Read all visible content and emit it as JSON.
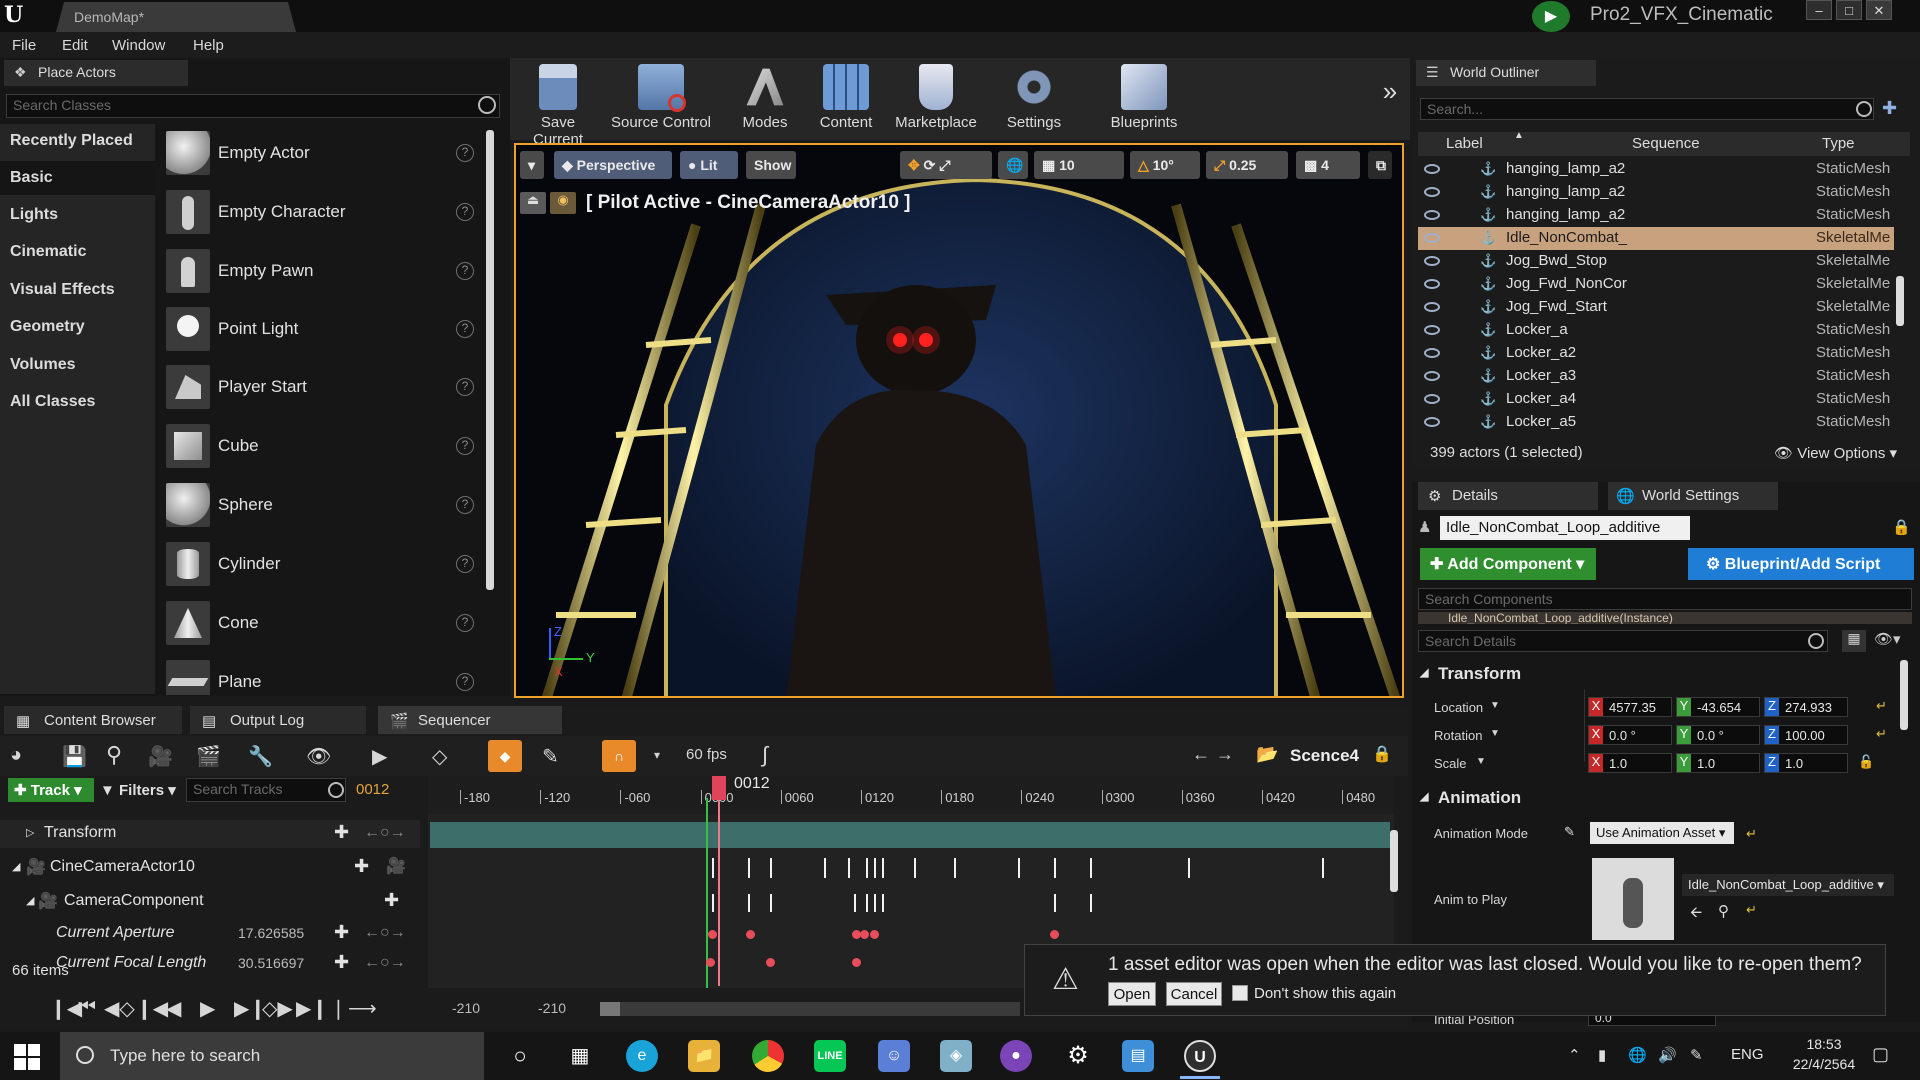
{
  "window": {
    "doc_tab": "DemoMap*",
    "project_name": "Pro2_VFX_Cinematic",
    "buttons": [
      "–",
      "□",
      "✕"
    ]
  },
  "menu": [
    "File",
    "Edit",
    "Window",
    "Help"
  ],
  "place_actors": {
    "tab": "Place Actors",
    "search_placeholder": "Search Classes",
    "categories": [
      "Recently Placed",
      "Basic",
      "Lights",
      "Cinematic",
      "Visual Effects",
      "Geometry",
      "Volumes",
      "All Classes"
    ],
    "selected_category": "Basic",
    "items": [
      "Empty Actor",
      "Empty Character",
      "Empty Pawn",
      "Point Light",
      "Player Start",
      "Cube",
      "Sphere",
      "Cylinder",
      "Cone",
      "Plane"
    ],
    "help": "?"
  },
  "toolbar": {
    "buttons": [
      "Save Current",
      "Source Control",
      "Modes",
      "Content",
      "Marketplace",
      "Settings",
      "Blueprints"
    ],
    "more": "»"
  },
  "viewport": {
    "perspective": "Perspective",
    "lit": "Lit",
    "show": "Show",
    "grid_snap": "10",
    "rotation_snap": "10°",
    "scale_snap": "0.25",
    "camera_speed": "4",
    "pilot_label": "[ Pilot Active - CineCameraActor10 ]",
    "axis_z": "Z",
    "axis_y": "Y",
    "axis_x": "X"
  },
  "outliner": {
    "tab": "World Outliner",
    "search_placeholder": "Search...",
    "col_label": "Label",
    "col_sequence": "Sequence",
    "col_type": "Type",
    "rows": [
      {
        "label": "hanging_lamp_a2",
        "type": "StaticMesh"
      },
      {
        "label": "hanging_lamp_a2",
        "type": "StaticMesh"
      },
      {
        "label": "hanging_lamp_a2",
        "type": "StaticMesh"
      },
      {
        "label": "Idle_NonCombat_",
        "type": "SkeletalMe"
      },
      {
        "label": "Jog_Bwd_Stop",
        "type": "SkeletalMe"
      },
      {
        "label": "Jog_Fwd_NonCor",
        "type": "SkeletalMe"
      },
      {
        "label": "Jog_Fwd_Start",
        "type": "SkeletalMe"
      },
      {
        "label": "Locker_a",
        "type": "StaticMesh"
      },
      {
        "label": "Locker_a2",
        "type": "StaticMesh"
      },
      {
        "label": "Locker_a3",
        "type": "StaticMesh"
      },
      {
        "label": "Locker_a4",
        "type": "StaticMesh"
      },
      {
        "label": "Locker_a5",
        "type": "StaticMesh"
      }
    ],
    "selected_index": 3,
    "count": "399 actors (1 selected)",
    "view_options": "View Options"
  },
  "details": {
    "tab": "Details",
    "world_settings_tab": "World Settings",
    "actor_name": "Idle_NonCombat_Loop_additive",
    "add_component": "Add Component",
    "blueprint_script": "Blueprint/Add Script",
    "search_components": "Search Components",
    "component_row": "Idle_NonCombat_Loop_additive(Instance)",
    "search_details": "Search Details",
    "transform_section": "Transform",
    "location_label": "Location",
    "rotation_label": "Rotation",
    "scale_label": "Scale",
    "location": {
      "x": "4577.35",
      "y": "-43.654",
      "z": "274.933"
    },
    "rotation": {
      "x": "0.0 °",
      "y": "0.0 °",
      "z": "100.00"
    },
    "scale": {
      "x": "1.0",
      "y": "1.0",
      "z": "1.0"
    },
    "animation_section": "Animation",
    "animation_mode_label": "Animation Mode",
    "animation_mode_value": "Use Animation Asset",
    "anim_to_play_label": "Anim to Play",
    "anim_asset": "Idle_NonCombat_Loop_additive",
    "initial_position_label": "Initial Position",
    "initial_position_value": "0.0"
  },
  "bottom_tabs": [
    "Content Browser",
    "Output Log",
    "Sequencer"
  ],
  "sequencer": {
    "fps": "60 fps",
    "sequence_name": "Scence4",
    "track_button": "Track",
    "filters": "Filters",
    "search_tracks_placeholder": "Search Tracks",
    "current_frame": "0012",
    "tracks": [
      {
        "name": "Transform",
        "indent": 1
      },
      {
        "name": "CineCameraActor10",
        "indent": 0
      },
      {
        "name": "CameraComponent",
        "indent": 1
      },
      {
        "name": "Current Aperture",
        "indent": 2,
        "value": "17.626585"
      },
      {
        "name": "Current Focal Length",
        "indent": 2,
        "value": "30.516697"
      }
    ],
    "item_count": "66 items",
    "ruler": [
      "-180",
      "-120",
      "-060",
      "0000",
      "0060",
      "0120",
      "0180",
      "0240",
      "0300",
      "0360",
      "0420",
      "0480"
    ],
    "range_start": "-210",
    "range_end": "-210"
  },
  "notification": {
    "message": "1 asset editor was open when the editor was last closed. Would you like to re-open them?",
    "open": "Open",
    "cancel": "Cancel",
    "dont_show": "Don't show this again"
  },
  "taskbar": {
    "search_placeholder": "Type here to search",
    "language": "ENG",
    "time": "18:53",
    "date": "22/4/2564"
  }
}
